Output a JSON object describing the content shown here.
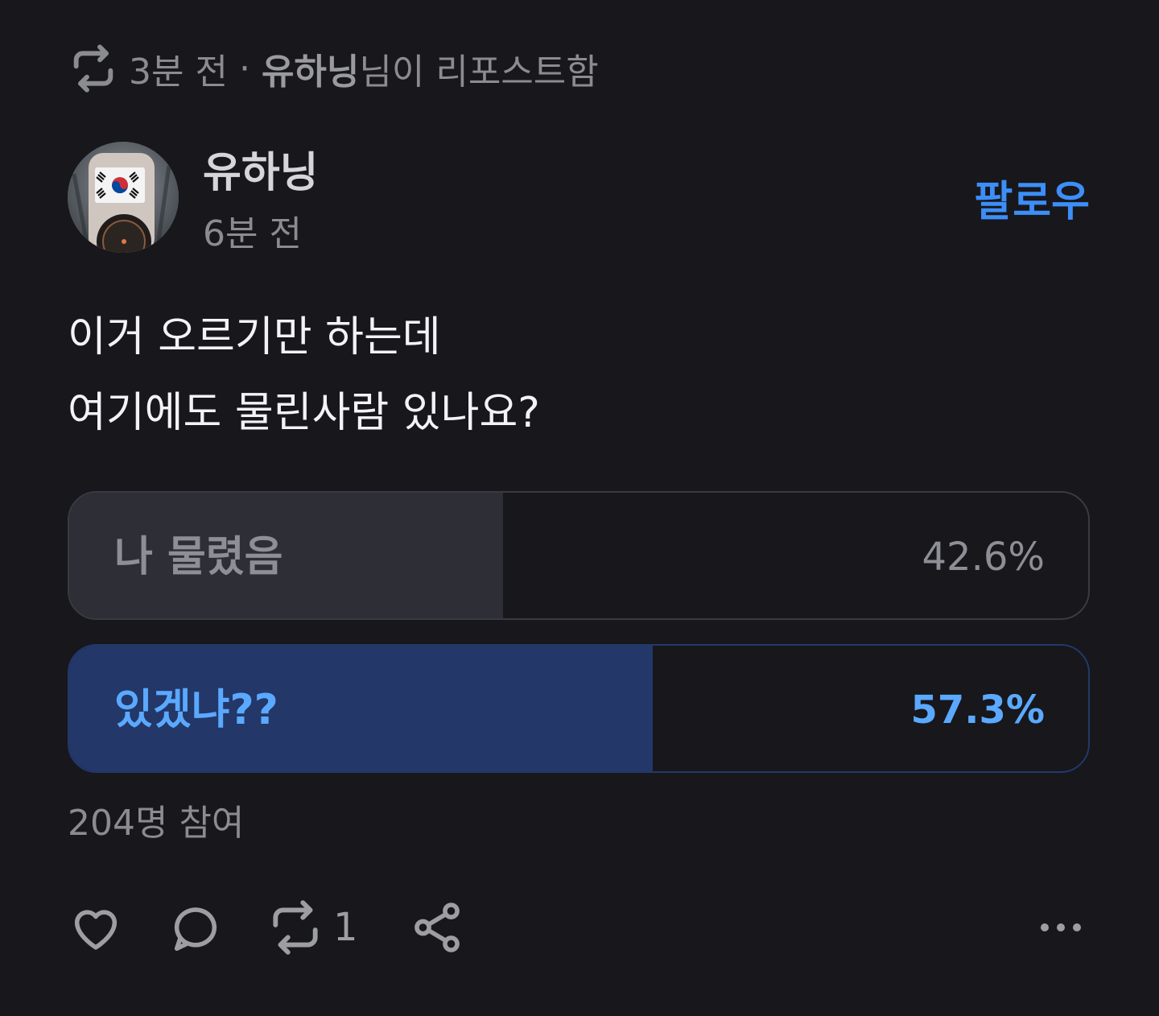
{
  "repost_header": {
    "time": "3분 전",
    "separator": "·",
    "reposter_name": "유하닝",
    "suffix": "님이 리포스트함",
    "icon": "repost-icon"
  },
  "post": {
    "author": {
      "name": "유하닝",
      "time": "6분 전",
      "avatar": "avatar-image"
    },
    "follow_label": "팔로우",
    "body_lines": [
      "이거 오르기만 하는데",
      "여기에도 물린사람 있나요?"
    ]
  },
  "poll": {
    "options": [
      {
        "label": "나 물렸음",
        "percent_text": "42.6%",
        "percent": 42.6,
        "selected": false
      },
      {
        "label": "있겠냐??",
        "percent_text": "57.3%",
        "percent": 57.3,
        "selected": true
      }
    ],
    "participants": "204명 참여"
  },
  "actions": {
    "like_icon": "heart-icon",
    "reply_icon": "speech-bubble-icon",
    "repost_icon": "repost-icon",
    "repost_count": "1",
    "share_icon": "share-icon",
    "more_icon": "more-icon"
  },
  "colors": {
    "background": "#17171c",
    "accent": "#3d8ef7",
    "selected_text": "#5aa9ff",
    "selected_fill": "#233769",
    "unselected_fill": "#2e2e36",
    "muted_text": "#8b8b92"
  }
}
